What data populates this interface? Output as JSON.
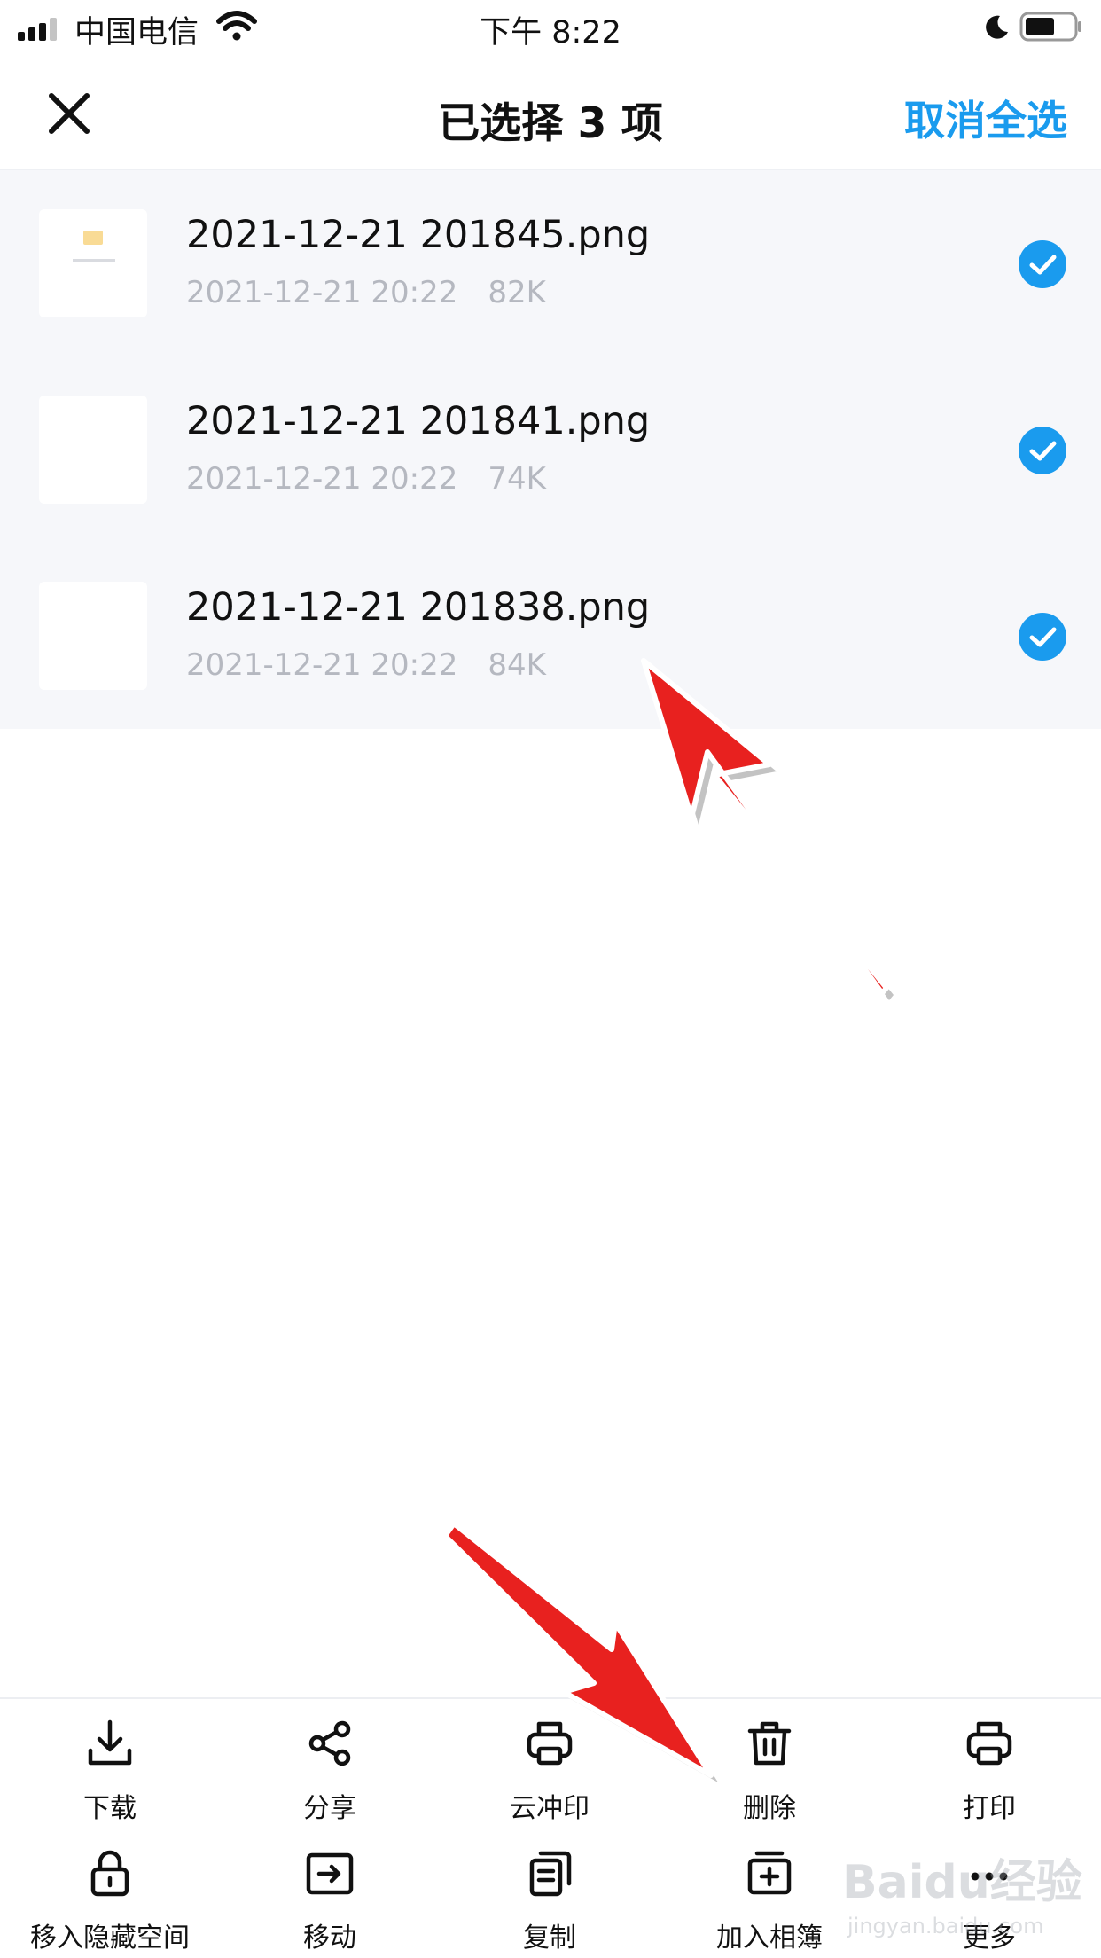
{
  "status_bar": {
    "carrier": "中国电信",
    "time": "下午 8:22"
  },
  "nav": {
    "title": "已选择 3 项",
    "cancel_select_all": "取消全选"
  },
  "files": [
    {
      "name": "2021-12-21 201845.png",
      "date": "2021-12-21 20:22",
      "size": "82K",
      "selected": true
    },
    {
      "name": "2021-12-21 201841.png",
      "date": "2021-12-21 20:22",
      "size": "74K",
      "selected": true
    },
    {
      "name": "2021-12-21 201838.png",
      "date": "2021-12-21 20:22",
      "size": "84K",
      "selected": true
    }
  ],
  "actions": [
    {
      "label": "下载",
      "icon": "download-icon"
    },
    {
      "label": "分享",
      "icon": "share-icon"
    },
    {
      "label": "云冲印",
      "icon": "cloud-print-icon"
    },
    {
      "label": "删除",
      "icon": "trash-icon"
    },
    {
      "label": "打印",
      "icon": "printer-icon"
    },
    {
      "label": "移入隐藏空间",
      "icon": "lock-icon"
    },
    {
      "label": "移动",
      "icon": "move-folder-icon"
    },
    {
      "label": "复制",
      "icon": "copy-icon"
    },
    {
      "label": "加入相簿",
      "icon": "add-album-icon"
    },
    {
      "label": "更多",
      "icon": "more-icon"
    }
  ],
  "colors": {
    "accent": "#1a9bee",
    "list_background": "#f6f7fa",
    "meta_text": "#b5b8c0",
    "annotation_arrow": "#e8211f"
  },
  "watermark": {
    "brand": "Baidu经验",
    "site": "jingyan.baidu.com"
  }
}
